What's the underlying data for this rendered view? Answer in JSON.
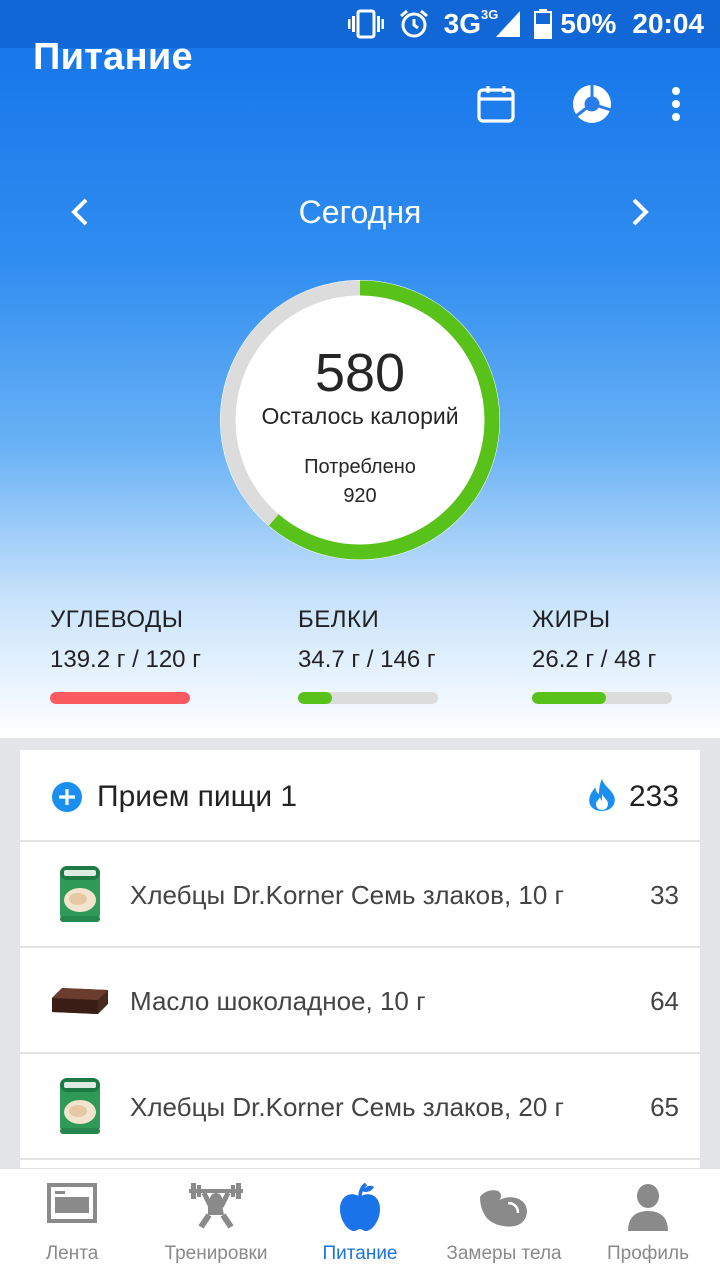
{
  "status_bar": {
    "network": "3G",
    "network_sup": "3G",
    "battery": "50%",
    "time": "20:04"
  },
  "app_bar": {
    "title": "Питание",
    "actions": [
      "calendar-icon",
      "pie-chart-icon",
      "more-vert-icon"
    ]
  },
  "date_nav": {
    "label": "Сегодня"
  },
  "calories": {
    "remaining": "580",
    "remaining_label": "Осталось калорий",
    "consumed_label": "Потреблено",
    "consumed": "920",
    "progress_fraction": 0.613,
    "ring_color": "#58c21a",
    "track_color": "#dcdcdc"
  },
  "macros": [
    {
      "name": "УГЛЕВОДЫ",
      "value": "139.2 г / 120 г",
      "fraction": 1.0,
      "color": "#f85a60"
    },
    {
      "name": "БЕЛКИ",
      "value": "34.7 г / 146 г",
      "fraction": 0.24,
      "color": "#58c21a"
    },
    {
      "name": "ЖИРЫ",
      "value": "26.2 г / 48 г",
      "fraction": 0.53,
      "color": "#58c21a"
    }
  ],
  "meal": {
    "title": "Прием пищи 1",
    "total": "233",
    "items": [
      {
        "name": "Хлебцы Dr.Korner Семь злаков, 10 г",
        "kcal": "33",
        "thumb": "crispbread-pack"
      },
      {
        "name": "Масло шоколадное, 10 г",
        "kcal": "64",
        "thumb": "chocolate-butter"
      },
      {
        "name": "Хлебцы Dr.Korner Семь злаков, 20 г",
        "kcal": "65",
        "thumb": "crispbread-pack"
      }
    ]
  },
  "bottom_nav": {
    "items": [
      {
        "label": "Лента",
        "icon": "feed-icon"
      },
      {
        "label": "Тренировки",
        "icon": "workout-icon"
      },
      {
        "label": "Питание",
        "icon": "apple-icon",
        "active": true
      },
      {
        "label": "Замеры тела",
        "icon": "bicep-icon"
      },
      {
        "label": "Профиль",
        "icon": "profile-icon"
      }
    ],
    "active_color": "#1a73e8",
    "inactive_color": "#8a8a8a"
  }
}
